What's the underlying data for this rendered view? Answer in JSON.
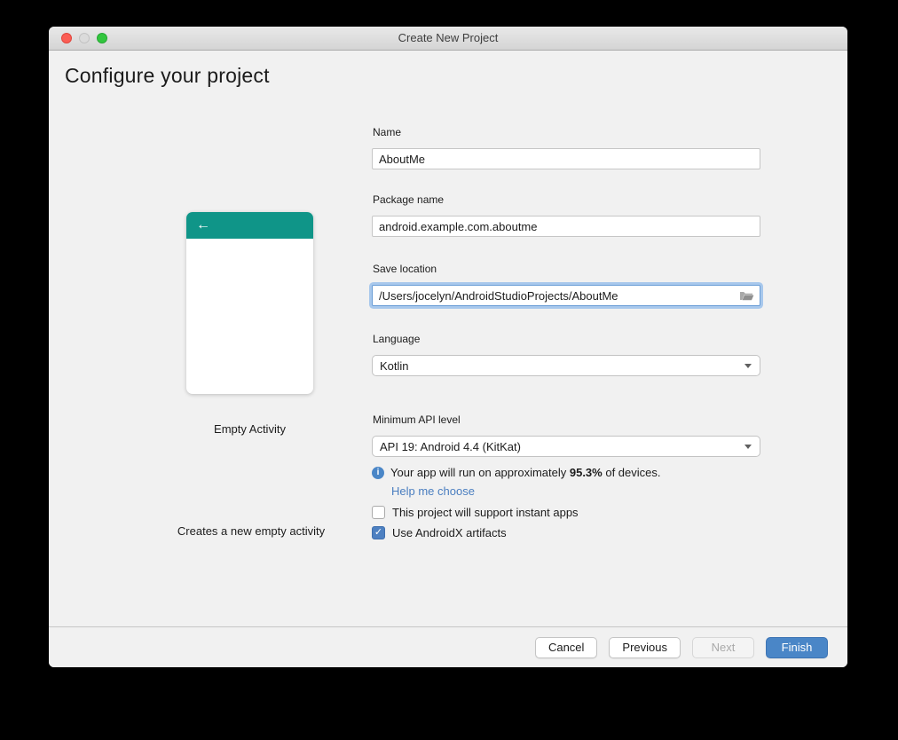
{
  "window": {
    "title": "Create New Project",
    "heading": "Configure your project"
  },
  "preview": {
    "template_name": "Empty Activity",
    "description": "Creates a new empty activity",
    "back_arrow": "←"
  },
  "form": {
    "name": {
      "label": "Name",
      "value": "AboutMe"
    },
    "package_name": {
      "label": "Package name",
      "value": "android.example.com.aboutme"
    },
    "save_location": {
      "label": "Save location",
      "value": "/Users/jocelyn/AndroidStudioProjects/AboutMe"
    },
    "language": {
      "label": "Language",
      "value": "Kotlin"
    },
    "min_api": {
      "label": "Minimum API level",
      "value": "API 19: Android 4.4 (KitKat)"
    },
    "api_info": {
      "prefix": "Your app will run on approximately ",
      "percent": "95.3%",
      "suffix": " of devices.",
      "link_label": "Help me choose"
    },
    "checkboxes": [
      {
        "label": "This project will support instant apps",
        "checked": false
      },
      {
        "label": "Use AndroidX artifacts",
        "checked": true
      }
    ]
  },
  "footer": {
    "buttons": [
      {
        "label": "Cancel",
        "disabled": false,
        "primary": false
      },
      {
        "label": "Previous",
        "disabled": false,
        "primary": false
      },
      {
        "label": "Next",
        "disabled": true,
        "primary": false
      },
      {
        "label": "Finish",
        "disabled": false,
        "primary": true
      }
    ]
  },
  "colors": {
    "teal": "#0F9588",
    "link_blue": "#4A7EC0",
    "primary_blue": "#4A86C7",
    "checkbox_blue": "#4D80C1",
    "focus_ring": "#A8C8EC",
    "info_blue": "#4A86C7"
  }
}
